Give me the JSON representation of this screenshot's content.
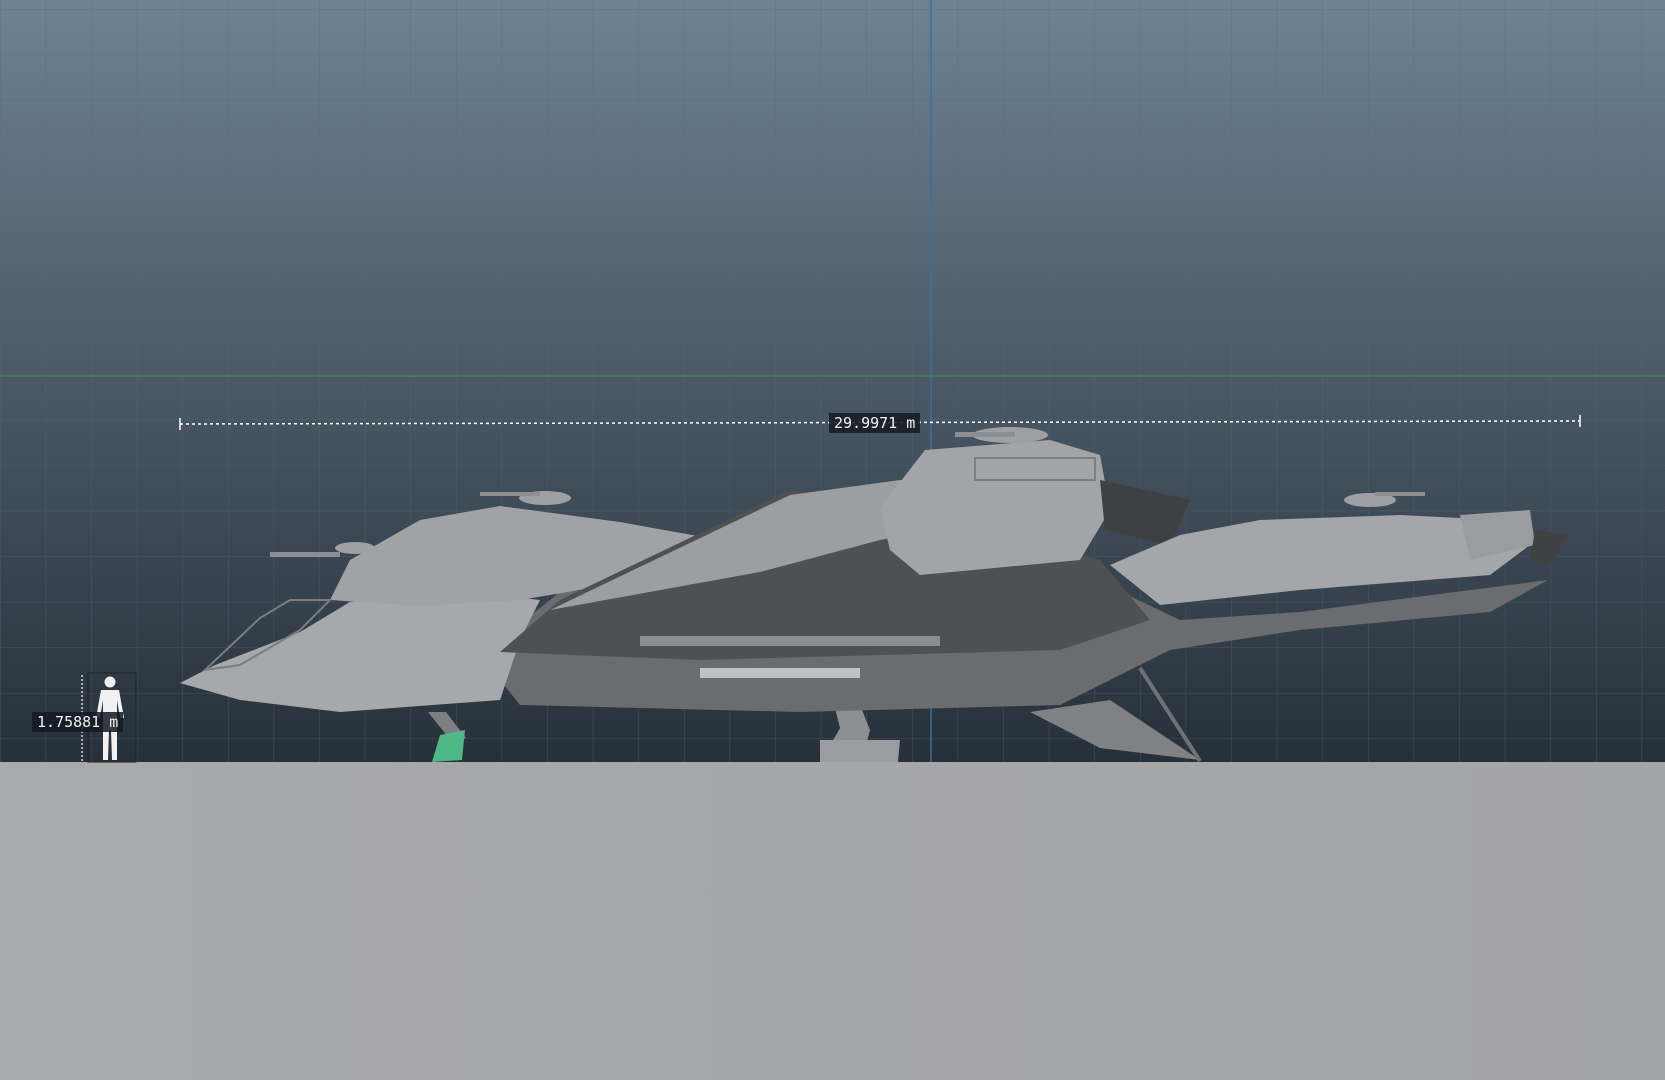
{
  "viewport": {
    "background_top": "#6e8293",
    "background_bottom": "#263039",
    "grid_color": "#55687a",
    "horizon_line_color": "#4f7a55",
    "vertical_axis_color": "#3f6f9a",
    "floor_color": "#a6a7a9"
  },
  "measurements": {
    "ship_length": "29.9971 m",
    "human_height": "1.75881 m"
  },
  "model": {
    "hull_light": "#a8aaad",
    "hull_mid": "#8a8c8f",
    "hull_dark": "#4e5052",
    "selected_part_color": "#4fb887"
  }
}
